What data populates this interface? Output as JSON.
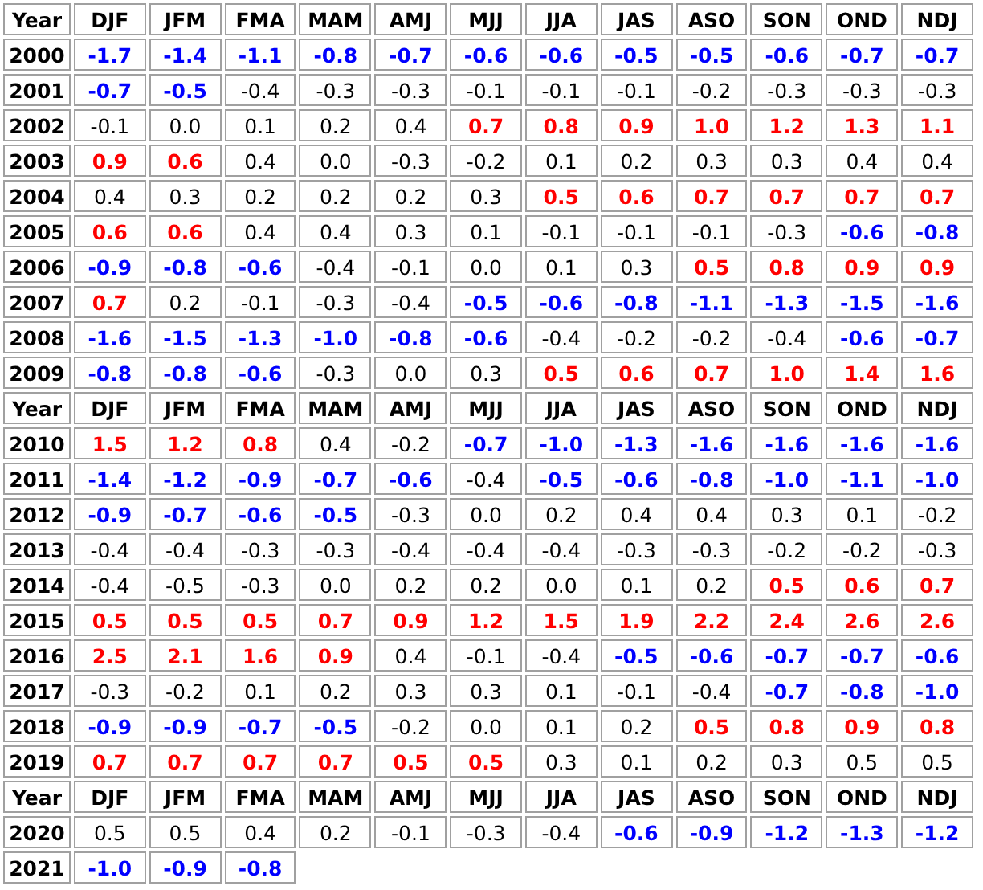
{
  "sections": [
    {
      "header": [
        "Year",
        "DJF",
        "JFM",
        "FMA",
        "MAM",
        "AMJ",
        "MJJ",
        "JJA",
        "JAS",
        "ASO",
        "SON",
        "OND",
        "NDJ"
      ],
      "rows": [
        {
          "year": "2000",
          "cells": [
            {
              "value": "-1.7",
              "kind": "cold"
            },
            {
              "value": "-1.4",
              "kind": "cold"
            },
            {
              "value": "-1.1",
              "kind": "cold"
            },
            {
              "value": "-0.8",
              "kind": "cold"
            },
            {
              "value": "-0.7",
              "kind": "cold"
            },
            {
              "value": "-0.6",
              "kind": "cold"
            },
            {
              "value": "-0.6",
              "kind": "cold"
            },
            {
              "value": "-0.5",
              "kind": "cold"
            },
            {
              "value": "-0.5",
              "kind": "cold"
            },
            {
              "value": "-0.6",
              "kind": "cold"
            },
            {
              "value": "-0.7",
              "kind": "cold"
            },
            {
              "value": "-0.7",
              "kind": "cold"
            }
          ]
        },
        {
          "year": "2001",
          "cells": [
            {
              "value": "-0.7",
              "kind": "cold"
            },
            {
              "value": "-0.5",
              "kind": "cold"
            },
            {
              "value": "-0.4",
              "kind": "neutral"
            },
            {
              "value": "-0.3",
              "kind": "neutral"
            },
            {
              "value": "-0.3",
              "kind": "neutral"
            },
            {
              "value": "-0.1",
              "kind": "neutral"
            },
            {
              "value": "-0.1",
              "kind": "neutral"
            },
            {
              "value": "-0.1",
              "kind": "neutral"
            },
            {
              "value": "-0.2",
              "kind": "neutral"
            },
            {
              "value": "-0.3",
              "kind": "neutral"
            },
            {
              "value": "-0.3",
              "kind": "neutral"
            },
            {
              "value": "-0.3",
              "kind": "neutral"
            }
          ]
        },
        {
          "year": "2002",
          "cells": [
            {
              "value": "-0.1",
              "kind": "neutral"
            },
            {
              "value": "0.0",
              "kind": "neutral"
            },
            {
              "value": "0.1",
              "kind": "neutral"
            },
            {
              "value": "0.2",
              "kind": "neutral"
            },
            {
              "value": "0.4",
              "kind": "neutral"
            },
            {
              "value": "0.7",
              "kind": "warm"
            },
            {
              "value": "0.8",
              "kind": "warm"
            },
            {
              "value": "0.9",
              "kind": "warm"
            },
            {
              "value": "1.0",
              "kind": "warm"
            },
            {
              "value": "1.2",
              "kind": "warm"
            },
            {
              "value": "1.3",
              "kind": "warm"
            },
            {
              "value": "1.1",
              "kind": "warm"
            }
          ]
        },
        {
          "year": "2003",
          "cells": [
            {
              "value": "0.9",
              "kind": "warm"
            },
            {
              "value": "0.6",
              "kind": "warm"
            },
            {
              "value": "0.4",
              "kind": "neutral"
            },
            {
              "value": "0.0",
              "kind": "neutral"
            },
            {
              "value": "-0.3",
              "kind": "neutral"
            },
            {
              "value": "-0.2",
              "kind": "neutral"
            },
            {
              "value": "0.1",
              "kind": "neutral"
            },
            {
              "value": "0.2",
              "kind": "neutral"
            },
            {
              "value": "0.3",
              "kind": "neutral"
            },
            {
              "value": "0.3",
              "kind": "neutral"
            },
            {
              "value": "0.4",
              "kind": "neutral"
            },
            {
              "value": "0.4",
              "kind": "neutral"
            }
          ]
        },
        {
          "year": "2004",
          "cells": [
            {
              "value": "0.4",
              "kind": "neutral"
            },
            {
              "value": "0.3",
              "kind": "neutral"
            },
            {
              "value": "0.2",
              "kind": "neutral"
            },
            {
              "value": "0.2",
              "kind": "neutral"
            },
            {
              "value": "0.2",
              "kind": "neutral"
            },
            {
              "value": "0.3",
              "kind": "neutral"
            },
            {
              "value": "0.5",
              "kind": "warm"
            },
            {
              "value": "0.6",
              "kind": "warm"
            },
            {
              "value": "0.7",
              "kind": "warm"
            },
            {
              "value": "0.7",
              "kind": "warm"
            },
            {
              "value": "0.7",
              "kind": "warm"
            },
            {
              "value": "0.7",
              "kind": "warm"
            }
          ]
        },
        {
          "year": "2005",
          "cells": [
            {
              "value": "0.6",
              "kind": "warm"
            },
            {
              "value": "0.6",
              "kind": "warm"
            },
            {
              "value": "0.4",
              "kind": "neutral"
            },
            {
              "value": "0.4",
              "kind": "neutral"
            },
            {
              "value": "0.3",
              "kind": "neutral"
            },
            {
              "value": "0.1",
              "kind": "neutral"
            },
            {
              "value": "-0.1",
              "kind": "neutral"
            },
            {
              "value": "-0.1",
              "kind": "neutral"
            },
            {
              "value": "-0.1",
              "kind": "neutral"
            },
            {
              "value": "-0.3",
              "kind": "neutral"
            },
            {
              "value": "-0.6",
              "kind": "cold"
            },
            {
              "value": "-0.8",
              "kind": "cold"
            }
          ]
        },
        {
          "year": "2006",
          "cells": [
            {
              "value": "-0.9",
              "kind": "cold"
            },
            {
              "value": "-0.8",
              "kind": "cold"
            },
            {
              "value": "-0.6",
              "kind": "cold"
            },
            {
              "value": "-0.4",
              "kind": "neutral"
            },
            {
              "value": "-0.1",
              "kind": "neutral"
            },
            {
              "value": "0.0",
              "kind": "neutral"
            },
            {
              "value": "0.1",
              "kind": "neutral"
            },
            {
              "value": "0.3",
              "kind": "neutral"
            },
            {
              "value": "0.5",
              "kind": "warm"
            },
            {
              "value": "0.8",
              "kind": "warm"
            },
            {
              "value": "0.9",
              "kind": "warm"
            },
            {
              "value": "0.9",
              "kind": "warm"
            }
          ]
        },
        {
          "year": "2007",
          "cells": [
            {
              "value": "0.7",
              "kind": "warm"
            },
            {
              "value": "0.2",
              "kind": "neutral"
            },
            {
              "value": "-0.1",
              "kind": "neutral"
            },
            {
              "value": "-0.3",
              "kind": "neutral"
            },
            {
              "value": "-0.4",
              "kind": "neutral"
            },
            {
              "value": "-0.5",
              "kind": "cold"
            },
            {
              "value": "-0.6",
              "kind": "cold"
            },
            {
              "value": "-0.8",
              "kind": "cold"
            },
            {
              "value": "-1.1",
              "kind": "cold"
            },
            {
              "value": "-1.3",
              "kind": "cold"
            },
            {
              "value": "-1.5",
              "kind": "cold"
            },
            {
              "value": "-1.6",
              "kind": "cold"
            }
          ]
        },
        {
          "year": "2008",
          "cells": [
            {
              "value": "-1.6",
              "kind": "cold"
            },
            {
              "value": "-1.5",
              "kind": "cold"
            },
            {
              "value": "-1.3",
              "kind": "cold"
            },
            {
              "value": "-1.0",
              "kind": "cold"
            },
            {
              "value": "-0.8",
              "kind": "cold"
            },
            {
              "value": "-0.6",
              "kind": "cold"
            },
            {
              "value": "-0.4",
              "kind": "neutral"
            },
            {
              "value": "-0.2",
              "kind": "neutral"
            },
            {
              "value": "-0.2",
              "kind": "neutral"
            },
            {
              "value": "-0.4",
              "kind": "neutral"
            },
            {
              "value": "-0.6",
              "kind": "cold"
            },
            {
              "value": "-0.7",
              "kind": "cold"
            }
          ]
        },
        {
          "year": "2009",
          "cells": [
            {
              "value": "-0.8",
              "kind": "cold"
            },
            {
              "value": "-0.8",
              "kind": "cold"
            },
            {
              "value": "-0.6",
              "kind": "cold"
            },
            {
              "value": "-0.3",
              "kind": "neutral"
            },
            {
              "value": "0.0",
              "kind": "neutral"
            },
            {
              "value": "0.3",
              "kind": "neutral"
            },
            {
              "value": "0.5",
              "kind": "warm"
            },
            {
              "value": "0.6",
              "kind": "warm"
            },
            {
              "value": "0.7",
              "kind": "warm"
            },
            {
              "value": "1.0",
              "kind": "warm"
            },
            {
              "value": "1.4",
              "kind": "warm"
            },
            {
              "value": "1.6",
              "kind": "warm"
            }
          ]
        }
      ]
    },
    {
      "header": [
        "Year",
        "DJF",
        "JFM",
        "FMA",
        "MAM",
        "AMJ",
        "MJJ",
        "JJA",
        "JAS",
        "ASO",
        "SON",
        "OND",
        "NDJ"
      ],
      "rows": [
        {
          "year": "2010",
          "cells": [
            {
              "value": "1.5",
              "kind": "warm"
            },
            {
              "value": "1.2",
              "kind": "warm"
            },
            {
              "value": "0.8",
              "kind": "warm"
            },
            {
              "value": "0.4",
              "kind": "neutral"
            },
            {
              "value": "-0.2",
              "kind": "neutral"
            },
            {
              "value": "-0.7",
              "kind": "cold"
            },
            {
              "value": "-1.0",
              "kind": "cold"
            },
            {
              "value": "-1.3",
              "kind": "cold"
            },
            {
              "value": "-1.6",
              "kind": "cold"
            },
            {
              "value": "-1.6",
              "kind": "cold"
            },
            {
              "value": "-1.6",
              "kind": "cold"
            },
            {
              "value": "-1.6",
              "kind": "cold"
            }
          ]
        },
        {
          "year": "2011",
          "cells": [
            {
              "value": "-1.4",
              "kind": "cold"
            },
            {
              "value": "-1.2",
              "kind": "cold"
            },
            {
              "value": "-0.9",
              "kind": "cold"
            },
            {
              "value": "-0.7",
              "kind": "cold"
            },
            {
              "value": "-0.6",
              "kind": "cold"
            },
            {
              "value": "-0.4",
              "kind": "neutral"
            },
            {
              "value": "-0.5",
              "kind": "cold"
            },
            {
              "value": "-0.6",
              "kind": "cold"
            },
            {
              "value": "-0.8",
              "kind": "cold"
            },
            {
              "value": "-1.0",
              "kind": "cold"
            },
            {
              "value": "-1.1",
              "kind": "cold"
            },
            {
              "value": "-1.0",
              "kind": "cold"
            }
          ]
        },
        {
          "year": "2012",
          "cells": [
            {
              "value": "-0.9",
              "kind": "cold"
            },
            {
              "value": "-0.7",
              "kind": "cold"
            },
            {
              "value": "-0.6",
              "kind": "cold"
            },
            {
              "value": "-0.5",
              "kind": "cold"
            },
            {
              "value": "-0.3",
              "kind": "neutral"
            },
            {
              "value": "0.0",
              "kind": "neutral"
            },
            {
              "value": "0.2",
              "kind": "neutral"
            },
            {
              "value": "0.4",
              "kind": "neutral"
            },
            {
              "value": "0.4",
              "kind": "neutral"
            },
            {
              "value": "0.3",
              "kind": "neutral"
            },
            {
              "value": "0.1",
              "kind": "neutral"
            },
            {
              "value": "-0.2",
              "kind": "neutral"
            }
          ]
        },
        {
          "year": "2013",
          "cells": [
            {
              "value": "-0.4",
              "kind": "neutral"
            },
            {
              "value": "-0.4",
              "kind": "neutral"
            },
            {
              "value": "-0.3",
              "kind": "neutral"
            },
            {
              "value": "-0.3",
              "kind": "neutral"
            },
            {
              "value": "-0.4",
              "kind": "neutral"
            },
            {
              "value": "-0.4",
              "kind": "neutral"
            },
            {
              "value": "-0.4",
              "kind": "neutral"
            },
            {
              "value": "-0.3",
              "kind": "neutral"
            },
            {
              "value": "-0.3",
              "kind": "neutral"
            },
            {
              "value": "-0.2",
              "kind": "neutral"
            },
            {
              "value": "-0.2",
              "kind": "neutral"
            },
            {
              "value": "-0.3",
              "kind": "neutral"
            }
          ]
        },
        {
          "year": "2014",
          "cells": [
            {
              "value": "-0.4",
              "kind": "neutral"
            },
            {
              "value": "-0.5",
              "kind": "neutral"
            },
            {
              "value": "-0.3",
              "kind": "neutral"
            },
            {
              "value": "0.0",
              "kind": "neutral"
            },
            {
              "value": "0.2",
              "kind": "neutral"
            },
            {
              "value": "0.2",
              "kind": "neutral"
            },
            {
              "value": "0.0",
              "kind": "neutral"
            },
            {
              "value": "0.1",
              "kind": "neutral"
            },
            {
              "value": "0.2",
              "kind": "neutral"
            },
            {
              "value": "0.5",
              "kind": "warm"
            },
            {
              "value": "0.6",
              "kind": "warm"
            },
            {
              "value": "0.7",
              "kind": "warm"
            }
          ]
        },
        {
          "year": "2015",
          "cells": [
            {
              "value": "0.5",
              "kind": "warm"
            },
            {
              "value": "0.5",
              "kind": "warm"
            },
            {
              "value": "0.5",
              "kind": "warm"
            },
            {
              "value": "0.7",
              "kind": "warm"
            },
            {
              "value": "0.9",
              "kind": "warm"
            },
            {
              "value": "1.2",
              "kind": "warm"
            },
            {
              "value": "1.5",
              "kind": "warm"
            },
            {
              "value": "1.9",
              "kind": "warm"
            },
            {
              "value": "2.2",
              "kind": "warm"
            },
            {
              "value": "2.4",
              "kind": "warm"
            },
            {
              "value": "2.6",
              "kind": "warm"
            },
            {
              "value": "2.6",
              "kind": "warm"
            }
          ]
        },
        {
          "year": "2016",
          "cells": [
            {
              "value": "2.5",
              "kind": "warm"
            },
            {
              "value": "2.1",
              "kind": "warm"
            },
            {
              "value": "1.6",
              "kind": "warm"
            },
            {
              "value": "0.9",
              "kind": "warm"
            },
            {
              "value": "0.4",
              "kind": "neutral"
            },
            {
              "value": "-0.1",
              "kind": "neutral"
            },
            {
              "value": "-0.4",
              "kind": "neutral"
            },
            {
              "value": "-0.5",
              "kind": "cold"
            },
            {
              "value": "-0.6",
              "kind": "cold"
            },
            {
              "value": "-0.7",
              "kind": "cold"
            },
            {
              "value": "-0.7",
              "kind": "cold"
            },
            {
              "value": "-0.6",
              "kind": "cold"
            }
          ]
        },
        {
          "year": "2017",
          "cells": [
            {
              "value": "-0.3",
              "kind": "neutral"
            },
            {
              "value": "-0.2",
              "kind": "neutral"
            },
            {
              "value": "0.1",
              "kind": "neutral"
            },
            {
              "value": "0.2",
              "kind": "neutral"
            },
            {
              "value": "0.3",
              "kind": "neutral"
            },
            {
              "value": "0.3",
              "kind": "neutral"
            },
            {
              "value": "0.1",
              "kind": "neutral"
            },
            {
              "value": "-0.1",
              "kind": "neutral"
            },
            {
              "value": "-0.4",
              "kind": "neutral"
            },
            {
              "value": "-0.7",
              "kind": "cold"
            },
            {
              "value": "-0.8",
              "kind": "cold"
            },
            {
              "value": "-1.0",
              "kind": "cold"
            }
          ]
        },
        {
          "year": "2018",
          "cells": [
            {
              "value": "-0.9",
              "kind": "cold"
            },
            {
              "value": "-0.9",
              "kind": "cold"
            },
            {
              "value": "-0.7",
              "kind": "cold"
            },
            {
              "value": "-0.5",
              "kind": "cold"
            },
            {
              "value": "-0.2",
              "kind": "neutral"
            },
            {
              "value": "0.0",
              "kind": "neutral"
            },
            {
              "value": "0.1",
              "kind": "neutral"
            },
            {
              "value": "0.2",
              "kind": "neutral"
            },
            {
              "value": "0.5",
              "kind": "warm"
            },
            {
              "value": "0.8",
              "kind": "warm"
            },
            {
              "value": "0.9",
              "kind": "warm"
            },
            {
              "value": "0.8",
              "kind": "warm"
            }
          ]
        },
        {
          "year": "2019",
          "cells": [
            {
              "value": "0.7",
              "kind": "warm"
            },
            {
              "value": "0.7",
              "kind": "warm"
            },
            {
              "value": "0.7",
              "kind": "warm"
            },
            {
              "value": "0.7",
              "kind": "warm"
            },
            {
              "value": "0.5",
              "kind": "warm"
            },
            {
              "value": "0.5",
              "kind": "warm"
            },
            {
              "value": "0.3",
              "kind": "neutral"
            },
            {
              "value": "0.1",
              "kind": "neutral"
            },
            {
              "value": "0.2",
              "kind": "neutral"
            },
            {
              "value": "0.3",
              "kind": "neutral"
            },
            {
              "value": "0.5",
              "kind": "neutral"
            },
            {
              "value": "0.5",
              "kind": "neutral"
            }
          ]
        }
      ]
    },
    {
      "header": [
        "Year",
        "DJF",
        "JFM",
        "FMA",
        "MAM",
        "AMJ",
        "MJJ",
        "JJA",
        "JAS",
        "ASO",
        "SON",
        "OND",
        "NDJ"
      ],
      "rows": [
        {
          "year": "2020",
          "cells": [
            {
              "value": "0.5",
              "kind": "neutral"
            },
            {
              "value": "0.5",
              "kind": "neutral"
            },
            {
              "value": "0.4",
              "kind": "neutral"
            },
            {
              "value": "0.2",
              "kind": "neutral"
            },
            {
              "value": "-0.1",
              "kind": "neutral"
            },
            {
              "value": "-0.3",
              "kind": "neutral"
            },
            {
              "value": "-0.4",
              "kind": "neutral"
            },
            {
              "value": "-0.6",
              "kind": "cold"
            },
            {
              "value": "-0.9",
              "kind": "cold"
            },
            {
              "value": "-1.2",
              "kind": "cold"
            },
            {
              "value": "-1.3",
              "kind": "cold"
            },
            {
              "value": "-1.2",
              "kind": "cold"
            }
          ]
        },
        {
          "year": "2021",
          "cells": [
            {
              "value": "-1.0",
              "kind": "cold"
            },
            {
              "value": "-0.9",
              "kind": "cold"
            },
            {
              "value": "-0.8",
              "kind": "cold"
            }
          ]
        }
      ]
    }
  ]
}
